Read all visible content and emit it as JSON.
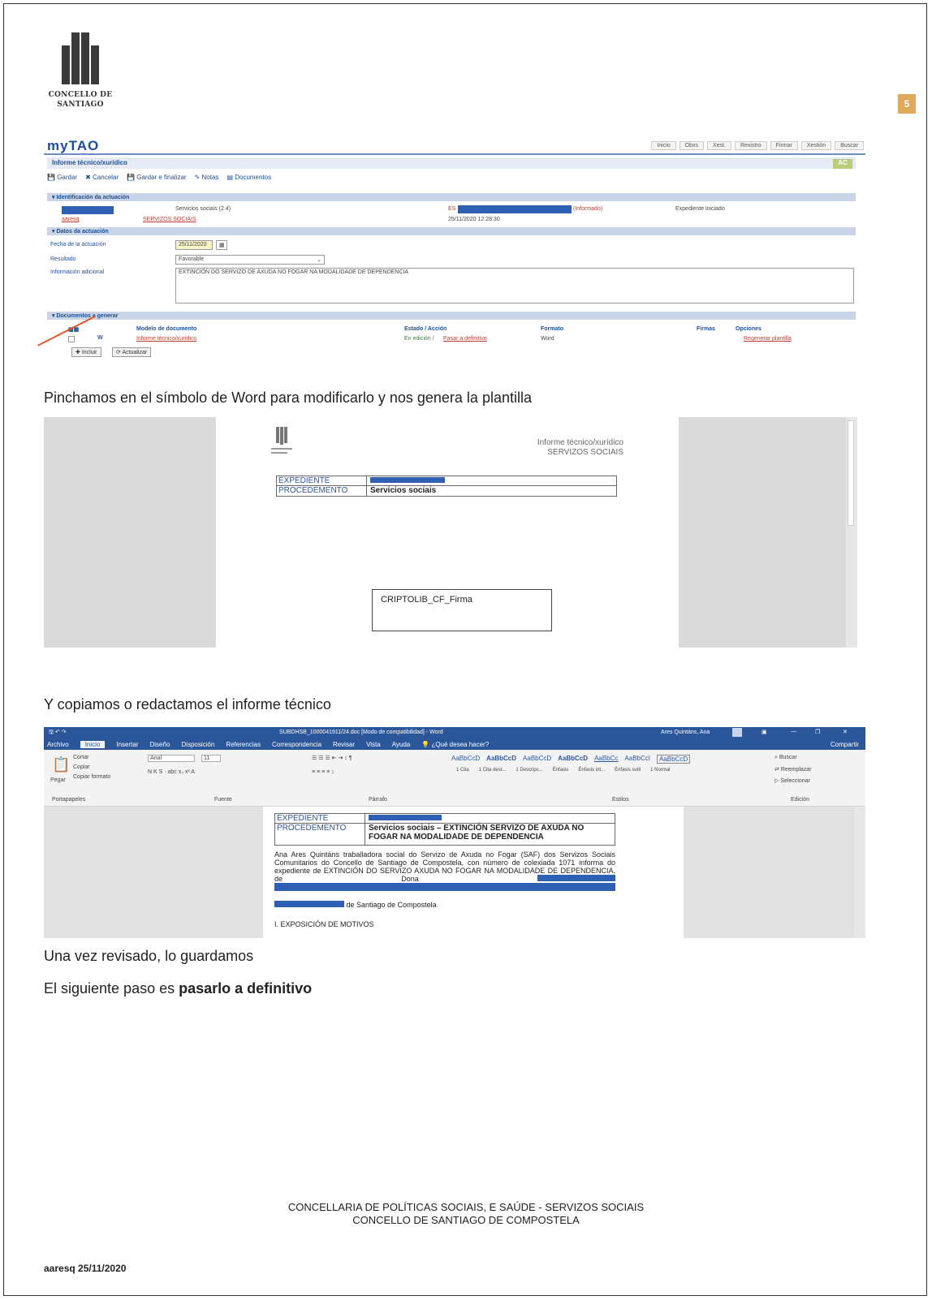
{
  "header": {
    "logo_line1": "CONCELLO DE",
    "logo_line2": "SANTIAGO",
    "page_number": "5"
  },
  "mytao": {
    "brand": "myTAO",
    "nav": [
      "Inicio",
      "Obxs",
      "Xest.",
      "Rexistro",
      "Firmar",
      "Xestión",
      "Buscar"
    ],
    "title": "Informe técnico/xurídico",
    "badge": "AC",
    "toolbar": [
      "Gardar",
      "Cancelar",
      "Gardar e finalizar",
      "Notas",
      "Documentos"
    ],
    "section1": "Identificación da actuación",
    "service": "Servicios sociais (2.4)",
    "link_left": "aaresq",
    "link_mid": "SERVIZOS SOCIAIS",
    "es_prefix": "ES",
    "informado": "(Informado)",
    "datetime": "25/11/2020 12:28:30",
    "estado": "Expediente iniciado",
    "section2": "Datos da actuación",
    "fecha_label": "Fecha de la actuación",
    "fecha_value": "25/11/2020",
    "resultado_label": "Resultado",
    "resultado_value": "Favorable",
    "info_label": "Información adicional",
    "info_value": "EXTINCIÓN DO SERVIZO DE AXUDA NO FOGAR NA MODALIDADE DE DEPENDENCIA",
    "section3": "Documentos a generar",
    "col_modelo": "Modelo de documento",
    "col_estado": "Estado / Acción",
    "col_formato": "Formato",
    "col_firmas": "Firmas",
    "col_opciones": "Opciones",
    "doc_name": "Informe técnico/xurídico",
    "doc_estado": "En edición /",
    "doc_action": "Pasar a definitivo",
    "doc_format": "Word",
    "doc_option": "Regenerar plantilla",
    "btn_incluir": "Incluir",
    "btn_actualizar": "Actualizar"
  },
  "caption1": "Pinchamos en el símbolo de Word para modificarlo y nos genera la plantilla",
  "template": {
    "heading1": "Informe técnico/xurídico",
    "heading2": "SERVIZOS SOCIAIS",
    "exp_label": "EXPEDIENTE",
    "proc_label": "PROCEDEMENTO",
    "proc_value": "Servicios sociais",
    "sign_box": "CRIPTOLIB_CF_Firma"
  },
  "caption2": "Y copiamos o redactamos el informe técnico",
  "word": {
    "window_title": "SUBDHSB_1000041911/24.doc [Modo de compatibilidad] - Word",
    "user": "Ares Quintáns, Ana",
    "share": "Compartir",
    "tabs": [
      "Archivo",
      "Inicio",
      "Insertar",
      "Diseño",
      "Disposición",
      "Referencias",
      "Correspondencia",
      "Revisar",
      "Vista",
      "Ayuda",
      "¿Qué desea hacer?"
    ],
    "clipboard": [
      "Cortar",
      "Copiar",
      "Copiar formato"
    ],
    "paste": "Pegar",
    "groups": [
      "Portapapeles",
      "Fuente",
      "Párrafo",
      "Estilos",
      "Edición"
    ],
    "font": "Arial",
    "size": "11",
    "styles": [
      "AaBbCcD",
      "AaBbCcD",
      "AaBbCcD",
      "AaBbCcD",
      "AaBbCc",
      "AaBbCcI",
      "AaBbCcD"
    ],
    "style_names": [
      "1 Cita",
      "1 Cita dest...",
      "1 Descripc...",
      "Énfasis",
      "Énfasis int...",
      "Énfasis sutil",
      "1 Normal"
    ],
    "edit": [
      "Buscar",
      "Reemplazar",
      "Seleccionar"
    ],
    "exp_label": "EXPEDIENTE",
    "proc_label": "PROCEDEMENTO",
    "proc_value": "Servicios sociais – EXTINCIÓN SERVIZO DE AXUDA NO FOGAR NA MODALIDADE DE DEPENDENCIA",
    "body": "Ana Ares Quintáns traballadora social do Servizo de Axuda no Fogar (SAF) dos Servizos Sociais Comunitarios do Concello de Santiago de Compostela, con número de colexiada 1071 informa do expediente de EXTINCIÓN DO SERVIZO AXUDA NO FOGAR NA MODALIDADE DE DEPENDENCIA, de Dona",
    "body_end": "de Santiago de Compostela",
    "section_heading": "I. EXPOSICIÓN DE MOTIVOS"
  },
  "caption3": "Una vez revisado, lo guardamos",
  "caption4_prefix": "El siguiente paso es ",
  "caption4_bold": "pasarlo a definitivo",
  "footer": {
    "line1": "CONCELLARIA DE POLÍTICAS SOCIAIS, E SAÚDE - SERVIZOS SOCIAIS",
    "line2": "CONCELLO DE SANTIAGO DE COMPOSTELA",
    "date": "aaresq 25/11/2020"
  },
  "colors": {
    "accent": "#2b579a",
    "redaction": "#2f5fb3",
    "badge": "#e0a85a"
  }
}
